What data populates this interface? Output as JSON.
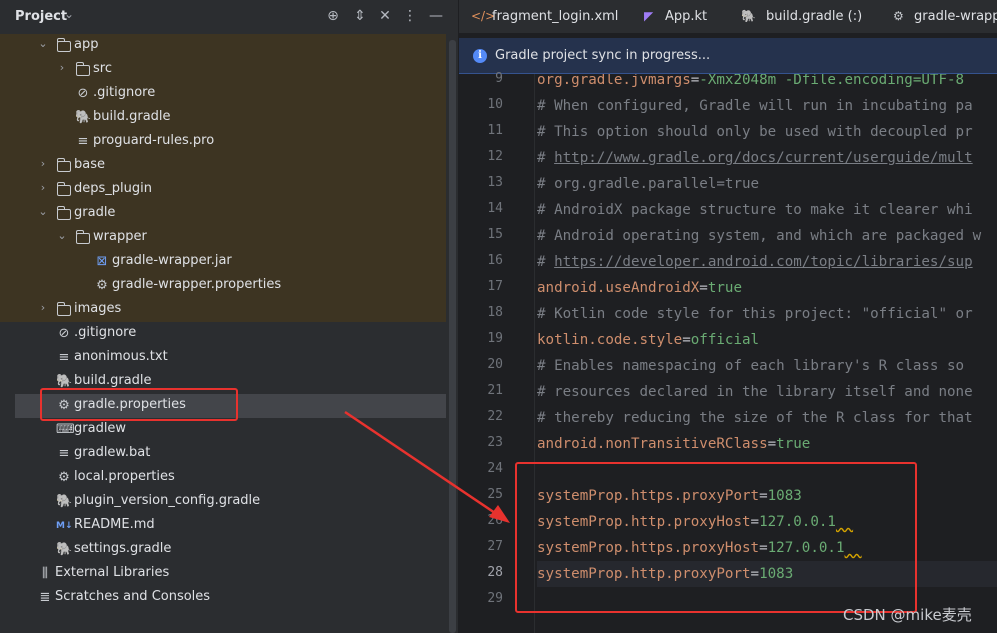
{
  "project_panel": {
    "title": "Project",
    "tree": [
      {
        "label": "app",
        "arrow": "⌄",
        "icon": "folder"
      },
      {
        "label": "src",
        "arrow": "›",
        "icon": "folder"
      },
      {
        "label": ".gitignore",
        "arrow": "",
        "icon": "ignore"
      },
      {
        "label": "build.gradle",
        "arrow": "",
        "icon": "gradle"
      },
      {
        "label": "proguard-rules.pro",
        "arrow": "",
        "icon": "text"
      },
      {
        "label": "base",
        "arrow": "›",
        "icon": "folder"
      },
      {
        "label": "deps_plugin",
        "arrow": "›",
        "icon": "folder"
      },
      {
        "label": "gradle",
        "arrow": "⌄",
        "icon": "folder"
      },
      {
        "label": "wrapper",
        "arrow": "⌄",
        "icon": "folder"
      },
      {
        "label": "gradle-wrapper.jar",
        "arrow": "",
        "icon": "jar"
      },
      {
        "label": "gradle-wrapper.properties",
        "arrow": "",
        "icon": "settings"
      },
      {
        "label": "images",
        "arrow": "›",
        "icon": "folder"
      },
      {
        "label": ".gitignore",
        "arrow": "",
        "icon": "ignore"
      },
      {
        "label": "anonimous.txt",
        "arrow": "",
        "icon": "text"
      },
      {
        "label": "build.gradle",
        "arrow": "",
        "icon": "gradle"
      },
      {
        "label": "gradle.properties",
        "arrow": "",
        "icon": "settings"
      },
      {
        "label": "gradlew",
        "arrow": "",
        "icon": "terminal"
      },
      {
        "label": "gradlew.bat",
        "arrow": "",
        "icon": "text"
      },
      {
        "label": "local.properties",
        "arrow": "",
        "icon": "settings"
      },
      {
        "label": "plugin_version_config.gradle",
        "arrow": "",
        "icon": "gradle"
      },
      {
        "label": "README.md",
        "arrow": "",
        "icon": "markdown"
      },
      {
        "label": "settings.gradle",
        "arrow": "",
        "icon": "gradle"
      },
      {
        "label": "External Libraries",
        "arrow": "",
        "icon": "library"
      },
      {
        "label": "Scratches and Consoles",
        "arrow": "",
        "icon": "scratches"
      }
    ]
  },
  "tabs": [
    {
      "label": "fragment_login.xml",
      "icon": "xml-icon"
    },
    {
      "label": "App.kt",
      "icon": "kotlin-icon"
    },
    {
      "label": "build.gradle (:)",
      "icon": "gradle-icon"
    },
    {
      "label": "gradle-wrappe",
      "icon": "settings-icon"
    }
  ],
  "banner": {
    "text": "Gradle project sync in progress..."
  },
  "editor": {
    "lines": [
      {
        "n": "9",
        "parts": [
          {
            "t": "org.gradle.jvmargs",
            "c": "key"
          },
          {
            "t": "=",
            "c": "eq"
          },
          {
            "t": "-Xmx2048m -Dfile.encoding=UTF-8",
            "c": "val"
          }
        ]
      },
      {
        "n": "10",
        "parts": [
          {
            "t": "# When configured, Gradle will run in incubating pa",
            "c": "cmt"
          }
        ]
      },
      {
        "n": "11",
        "parts": [
          {
            "t": "# This option should only be used with decoupled pr",
            "c": "cmt"
          }
        ]
      },
      {
        "n": "12",
        "parts": [
          {
            "t": "# ",
            "c": "cmt"
          },
          {
            "t": "http://www.gradle.org/docs/current/userguide/mult",
            "c": "lnk"
          }
        ]
      },
      {
        "n": "13",
        "parts": [
          {
            "t": "# org.gradle.parallel=true",
            "c": "cmt"
          }
        ]
      },
      {
        "n": "14",
        "parts": [
          {
            "t": "# AndroidX package structure to make it clearer whi",
            "c": "cmt"
          }
        ]
      },
      {
        "n": "15",
        "parts": [
          {
            "t": "# Android operating system, and which are packaged w",
            "c": "cmt"
          }
        ]
      },
      {
        "n": "16",
        "parts": [
          {
            "t": "# ",
            "c": "cmt"
          },
          {
            "t": "https://developer.android.com/topic/libraries/sup",
            "c": "lnk"
          }
        ]
      },
      {
        "n": "17",
        "parts": [
          {
            "t": "android.useAndroidX",
            "c": "key"
          },
          {
            "t": "=",
            "c": "eq"
          },
          {
            "t": "true",
            "c": "val"
          }
        ]
      },
      {
        "n": "18",
        "parts": [
          {
            "t": "# Kotlin code style for this project: \"official\" or",
            "c": "cmt"
          }
        ]
      },
      {
        "n": "19",
        "parts": [
          {
            "t": "kotlin.code.style",
            "c": "key"
          },
          {
            "t": "=",
            "c": "eq"
          },
          {
            "t": "official",
            "c": "val"
          }
        ]
      },
      {
        "n": "20",
        "parts": [
          {
            "t": "# Enables namespacing of each library's R class so",
            "c": "cmt"
          }
        ]
      },
      {
        "n": "21",
        "parts": [
          {
            "t": "# resources declared in the library itself and none",
            "c": "cmt"
          }
        ]
      },
      {
        "n": "22",
        "parts": [
          {
            "t": "# thereby reducing the size of the R class for that",
            "c": "cmt"
          }
        ]
      },
      {
        "n": "23",
        "parts": [
          {
            "t": "android.nonTransitiveRClass",
            "c": "key"
          },
          {
            "t": "=",
            "c": "eq"
          },
          {
            "t": "true",
            "c": "val"
          }
        ]
      },
      {
        "n": "24",
        "parts": []
      },
      {
        "n": "25",
        "parts": [
          {
            "t": "systemProp.https.proxyPort",
            "c": "key"
          },
          {
            "t": "=",
            "c": "eq"
          },
          {
            "t": "1083",
            "c": "val"
          }
        ]
      },
      {
        "n": "26",
        "parts": [
          {
            "t": "systemProp.http.proxyHost",
            "c": "key"
          },
          {
            "t": "=",
            "c": "eq"
          },
          {
            "t": "127.0.0.1",
            "c": "val"
          },
          {
            "t": "  ",
            "c": "wavy"
          }
        ]
      },
      {
        "n": "27",
        "parts": [
          {
            "t": "systemProp.https.proxyHost",
            "c": "key"
          },
          {
            "t": "=",
            "c": "eq"
          },
          {
            "t": "127.0.0.1",
            "c": "val"
          },
          {
            "t": "  ",
            "c": "wavy"
          }
        ]
      },
      {
        "n": "28",
        "parts": [
          {
            "t": "systemProp.http.proxyPort",
            "c": "key"
          },
          {
            "t": "=",
            "c": "eq"
          },
          {
            "t": "1083",
            "c": "val"
          }
        ]
      },
      {
        "n": "29",
        "parts": []
      }
    ],
    "current_line": "28"
  },
  "watermark": "CSDN @mike麦壳",
  "colors": {
    "annotation": "#e8322e",
    "key": "#cf8e6d",
    "value": "#6aab73",
    "comment": "#7a7e85"
  }
}
